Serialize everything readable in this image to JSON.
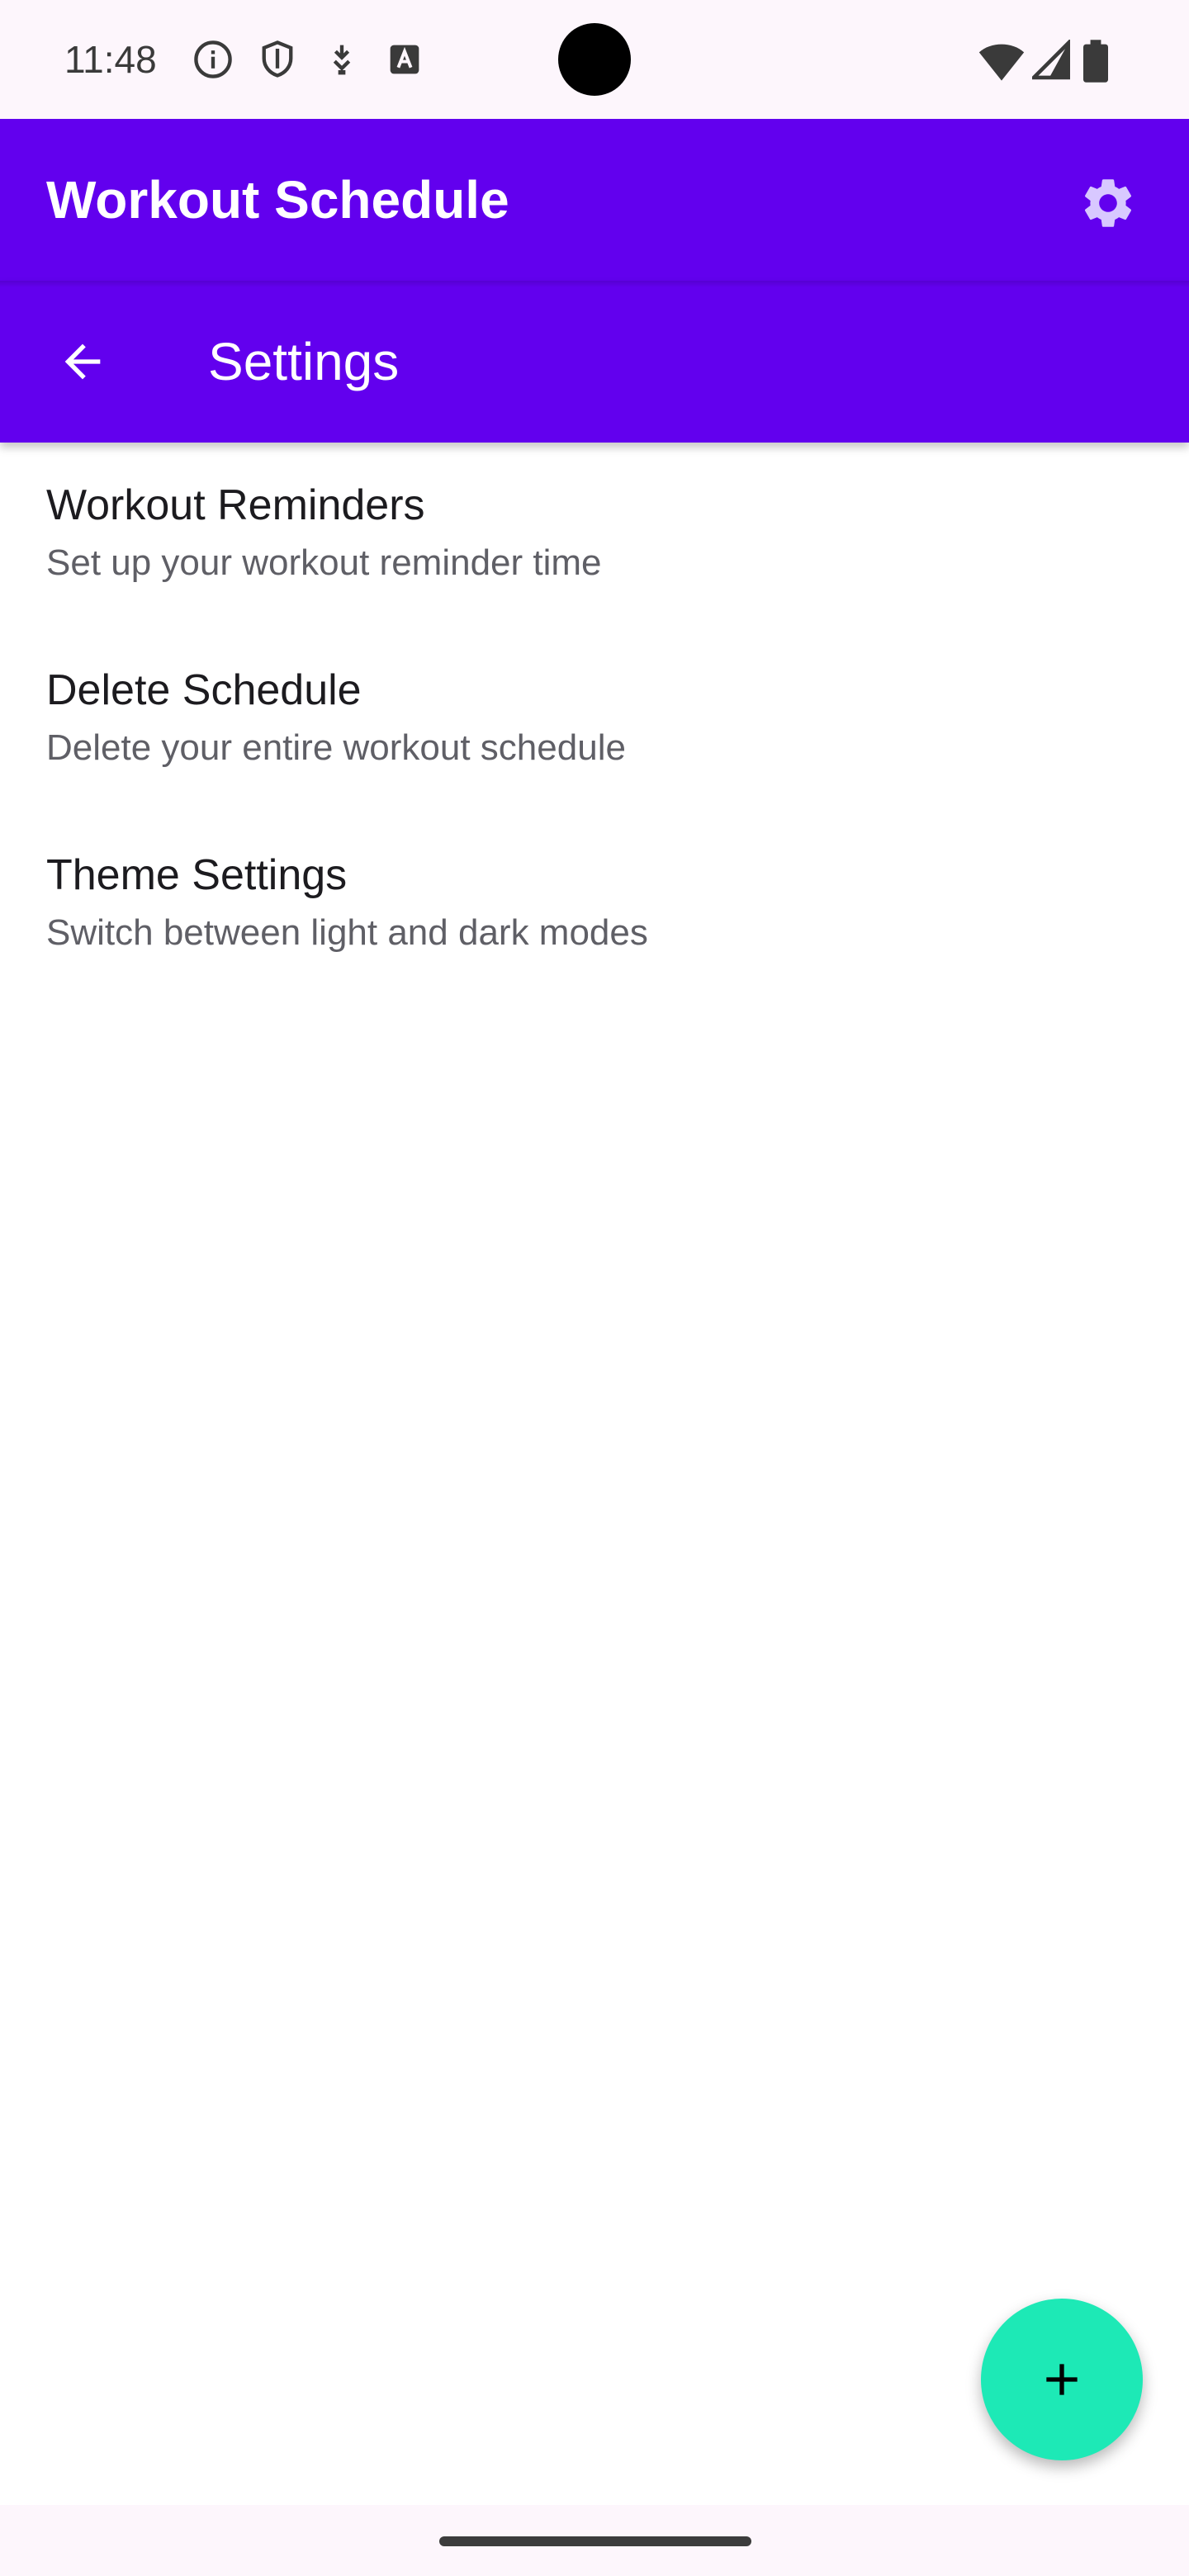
{
  "status_bar": {
    "time": "11:48",
    "icons": [
      "info-icon",
      "shield-icon",
      "usb-debug-icon",
      "font-a-icon"
    ],
    "system_icons": [
      "wifi-icon",
      "cell-signal-icon",
      "battery-icon"
    ]
  },
  "app_bar": {
    "title": "Workout Schedule",
    "action_icon": "gear-icon"
  },
  "settings_bar": {
    "title": "Settings",
    "nav_icon": "back-arrow-icon"
  },
  "settings": {
    "items": [
      {
        "title": "Workout Reminders",
        "subtitle": "Set up your workout reminder time"
      },
      {
        "title": "Delete Schedule",
        "subtitle": "Delete your entire workout schedule"
      },
      {
        "title": "Theme Settings",
        "subtitle": "Switch between light and dark modes"
      }
    ]
  },
  "fab": {
    "icon": "plus-icon"
  },
  "colors": {
    "primary": "#6200ee",
    "secondary": "#1de9b6",
    "status_bar_bg": "#fdf6fc"
  }
}
